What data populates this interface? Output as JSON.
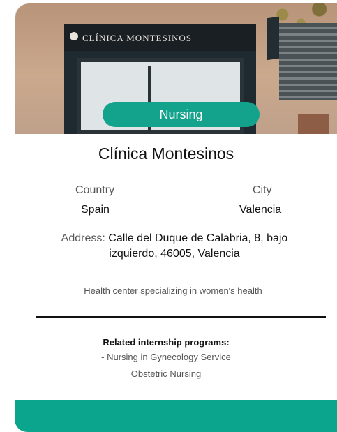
{
  "card": {
    "image_alt": "CLÍNICA MONTESINOS",
    "category_badge": "Nursing",
    "title": "Clínica Montesinos",
    "country_label": "Country",
    "country_value": "Spain",
    "city_label": "City",
    "city_value": "Valencia",
    "address_label": "Address:",
    "address_value": "Calle del Duque de Calabria, 8, bajo izquierdo, 46005, Valencia",
    "description": "Health center specializing in women's health",
    "related_title": "Related internship programs:",
    "programs": [
      "- Nursing in Gynecology Service",
      "Obstetric Nursing"
    ]
  },
  "colors": {
    "accent": "#13a38d",
    "footer": "#0ba48d"
  }
}
